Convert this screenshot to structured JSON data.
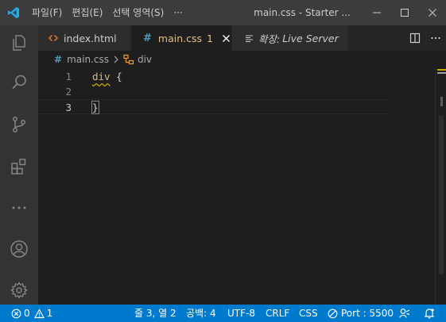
{
  "titlebar": {
    "menu": [
      "파일(F)",
      "편집(E)",
      "선택 영역(S)",
      "···"
    ],
    "title": "main.css - Starter ...",
    "colors": {
      "logo": "#23a9f2"
    }
  },
  "activitybar": {
    "icons": [
      "files-icon",
      "search-icon",
      "source-control-icon",
      "extensions-icon",
      "more-icon",
      "account-icon",
      "settings-gear-icon"
    ]
  },
  "tabs": [
    {
      "label": "index.html",
      "icon": "html-icon"
    },
    {
      "label": "main.css",
      "badge": "1",
      "icon": "css-hash-icon",
      "active": true
    },
    {
      "label_prefix": "확장:",
      "label": "Live Server",
      "icon": "preview-icon"
    }
  ],
  "breadcrumb": {
    "file": "main.css",
    "symbol": "div"
  },
  "editor": {
    "lines": [
      {
        "number": "1",
        "selector": "div",
        "text": " {"
      },
      {
        "number": "2",
        "text": ""
      },
      {
        "number": "3",
        "text": "}"
      }
    ]
  },
  "statusbar": {
    "errors": "0",
    "warnings": "1",
    "position": "줄 3, 열 2",
    "indent": "공백: 4",
    "encoding": "UTF-8",
    "eol": "CRLF",
    "language": "CSS",
    "port": "Port : 5500",
    "colors": {
      "background": "#007acc"
    }
  }
}
